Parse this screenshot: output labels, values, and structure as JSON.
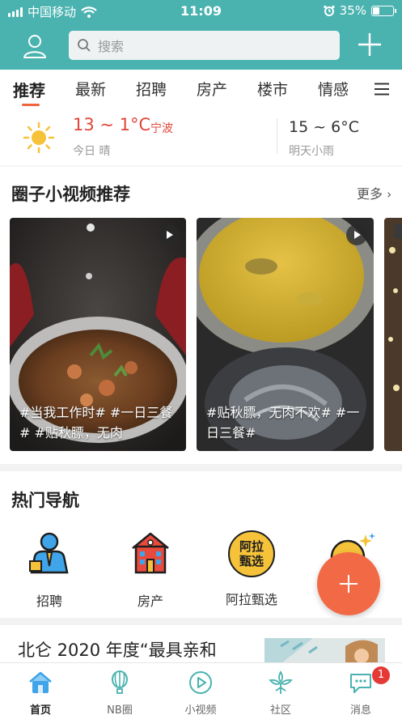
{
  "status_bar": {
    "carrier": "中国移动",
    "time": "11:09",
    "battery_percent": "35%",
    "battery_level": 0.35
  },
  "header": {
    "search_placeholder": "搜索",
    "accent_color": "#4ab3b0"
  },
  "tabs": [
    {
      "label": "推荐",
      "active": true
    },
    {
      "label": "最新"
    },
    {
      "label": "招聘"
    },
    {
      "label": "房产"
    },
    {
      "label": "楼市"
    },
    {
      "label": "情感"
    }
  ],
  "weather": {
    "today_temp": "13 ~ 1°C",
    "city": "宁波",
    "today_desc": "今日 晴",
    "tomorrow_temp": "15 ~ 6°C",
    "tomorrow_desc": "明天小雨"
  },
  "videos": {
    "title": "圈子小视频推荐",
    "more": "更多",
    "items": [
      {
        "caption": "#当我工作时# #一日三餐# #贴秋膘，无肉"
      },
      {
        "caption": "#贴秋膘，无肉不欢# #一日三餐#"
      }
    ]
  },
  "hot_nav": {
    "title": "热门导航",
    "items": [
      {
        "label": "招聘",
        "icon": "briefcase-person-icon"
      },
      {
        "label": "房产",
        "icon": "building-icon"
      },
      {
        "label": "阿拉甄选",
        "icon": "ala-select-logo",
        "logo_text": "阿拉甄选"
      }
    ]
  },
  "news": {
    "title": "北仑 2020 年度“最具亲和"
  },
  "bottom_nav": [
    {
      "label": "首页",
      "active": true
    },
    {
      "label": "NB圈"
    },
    {
      "label": "小视频"
    },
    {
      "label": "社区"
    },
    {
      "label": "消息"
    }
  ],
  "message_badge": "1"
}
